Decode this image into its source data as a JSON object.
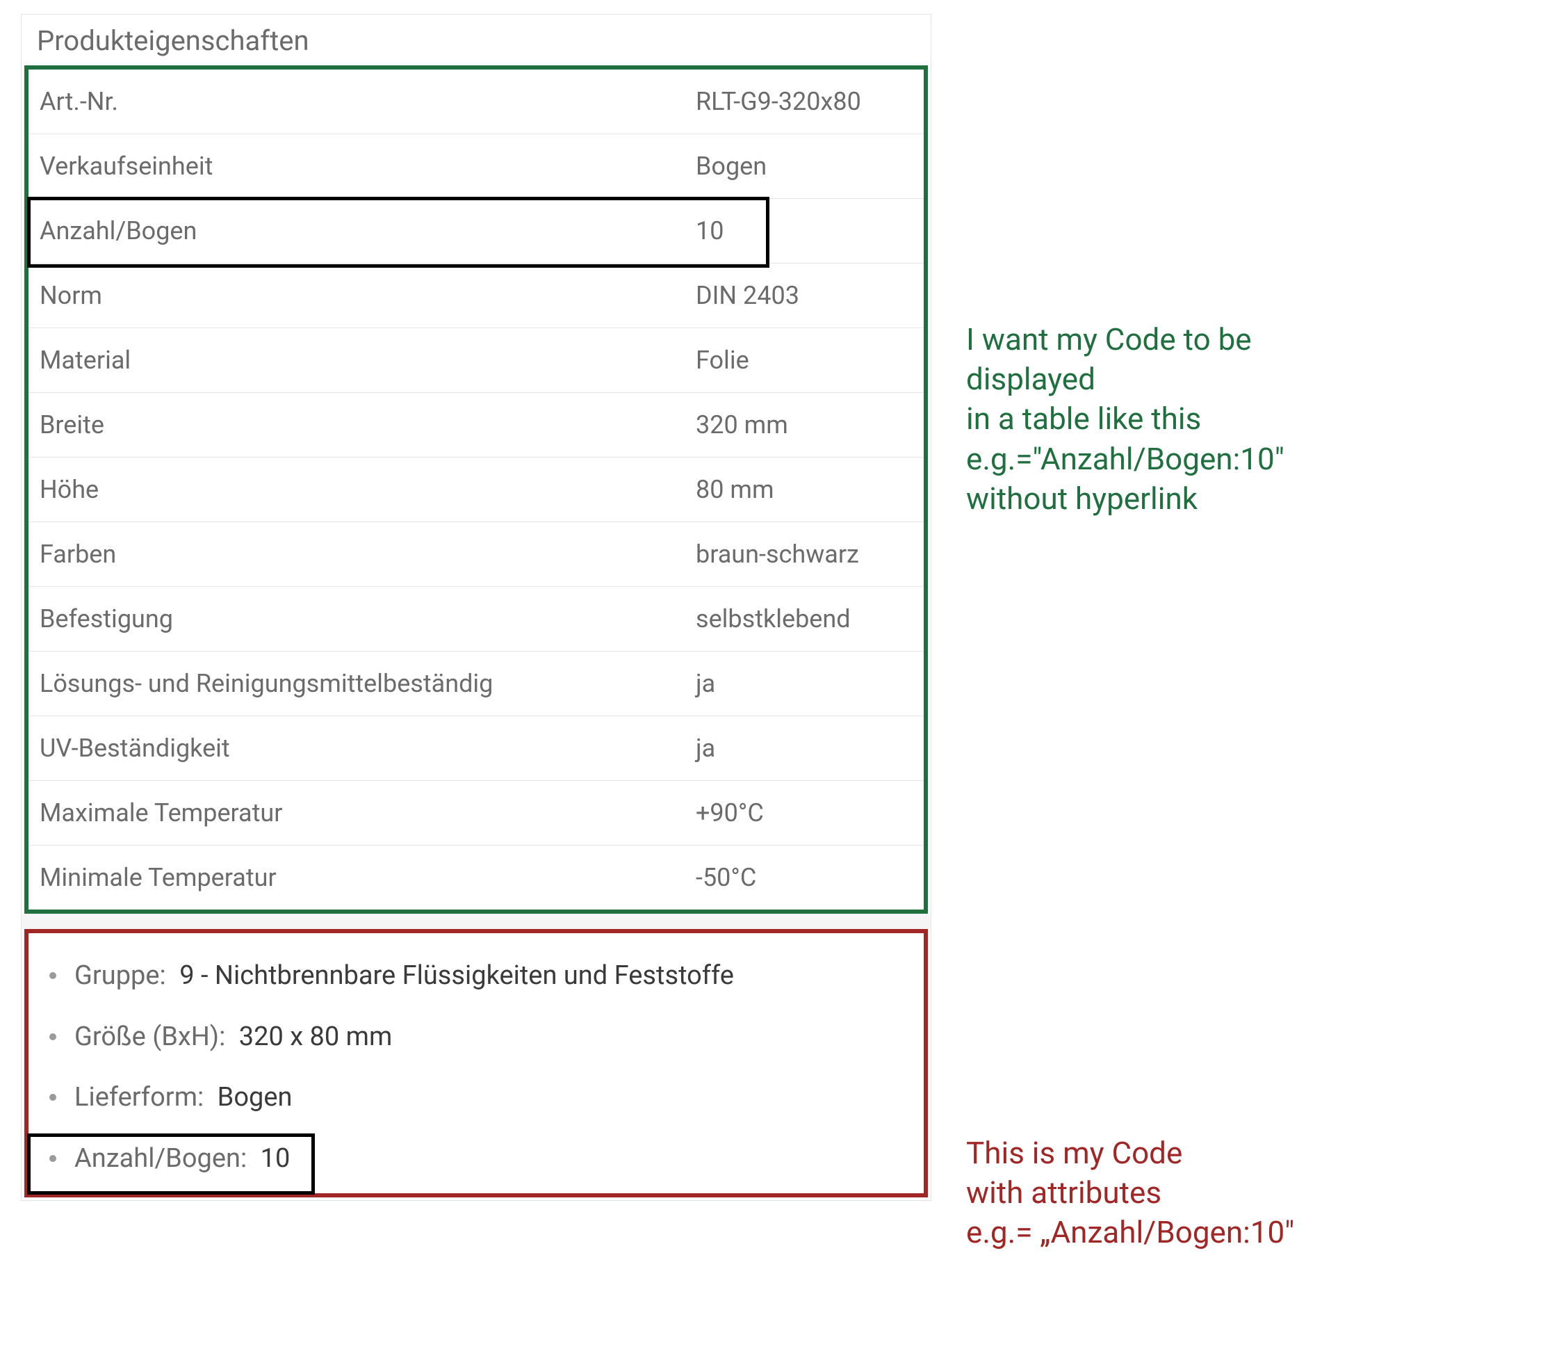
{
  "panel_title": "Produkteigenschaften",
  "props": [
    {
      "label": "Art.-Nr.",
      "value": "RLT-G9-320x80"
    },
    {
      "label": "Verkaufseinheit",
      "value": "Bogen"
    },
    {
      "label": "Anzahl/Bogen",
      "value": "10"
    },
    {
      "label": "Norm",
      "value": "DIN 2403"
    },
    {
      "label": "Material",
      "value": "Folie"
    },
    {
      "label": "Breite",
      "value": "320 mm"
    },
    {
      "label": "Höhe",
      "value": "80 mm"
    },
    {
      "label": "Farben",
      "value": "braun-schwarz"
    },
    {
      "label": "Befestigung",
      "value": "selbstklebend"
    },
    {
      "label": "Lösungs- und Reinigungsmittelbeständig",
      "value": "ja"
    },
    {
      "label": "UV-Beständigkeit",
      "value": "ja"
    },
    {
      "label": "Maximale Temperatur",
      "value": "+90°C"
    },
    {
      "label": "Minimale Temperatur",
      "value": "-50°C"
    }
  ],
  "bullets": [
    {
      "label": "Gruppe:",
      "value": "9 - Nichtbrennbare Flüssigkeiten und Feststoffe"
    },
    {
      "label": "Größe (BxH):",
      "value": "320 x 80 mm"
    },
    {
      "label": "Lieferform:",
      "value": "Bogen"
    },
    {
      "label": "Anzahl/Bogen:",
      "value": "10"
    }
  ],
  "annotations": {
    "green": "I want my Code to be\ndisplayed\nin a table like this\ne.g.=\"Anzahl/Bogen:10\"\nwithout hyperlink",
    "red": "This is my Code\nwith attributes\ne.g.= „Anzahl/Bogen:10\""
  }
}
